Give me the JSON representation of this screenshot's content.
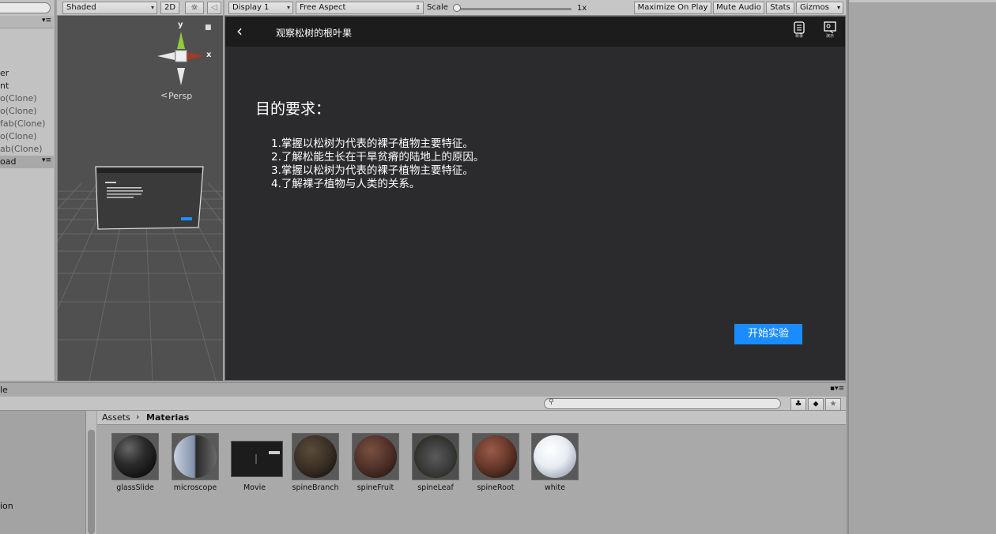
{
  "scene_toolbar": {
    "shading_mode": "Shaded",
    "mode_2d": "2D",
    "light_icon": "sun-icon",
    "audio_icon": "speaker-icon"
  },
  "game_toolbar": {
    "display": "Display 1",
    "aspect": "Free Aspect",
    "scale_label": "Scale",
    "scale_value": "1x",
    "maximize_on_play": "Maximize On Play",
    "mute_audio": "Mute Audio",
    "stats": "Stats",
    "gizmos": "Gizmos"
  },
  "hierarchy": {
    "items": [
      "er",
      "nt",
      "o(Clone)",
      "o(Clone)",
      "fab(Clone)",
      "o(Clone)",
      "ab(Clone)"
    ],
    "selected": "oad"
  },
  "scene_view": {
    "axis_y": "y",
    "axis_x": "x",
    "persp_label": "Persp"
  },
  "game_view": {
    "title": "观察松树的根叶果",
    "icon1_label": "目录",
    "icon2_label": "演示",
    "section_title": "目的要求：",
    "requirements": [
      "1.掌握以松树为代表的裸子植物主要特征。",
      "2.了解松能生长在干旱贫瘠的陆地上的原因。",
      "3.掌握以松树为代表的裸子植物主要特征。",
      "4.了解裸子植物与人类的关系。"
    ],
    "start_button": "开始实验"
  },
  "project": {
    "left_partial_top": "le",
    "left_partial_bottom": "ion",
    "breadcrumb_root": "Assets",
    "breadcrumb_current": "Materias",
    "assets": [
      {
        "name": "glassSlide",
        "kind": "material"
      },
      {
        "name": "microscope",
        "kind": "material"
      },
      {
        "name": "Movie",
        "kind": "render-texture"
      },
      {
        "name": "spineBranch",
        "kind": "material"
      },
      {
        "name": "spineFruit",
        "kind": "material"
      },
      {
        "name": "spineLeaf",
        "kind": "material"
      },
      {
        "name": "spineRoot",
        "kind": "material"
      },
      {
        "name": "white",
        "kind": "material"
      }
    ]
  }
}
